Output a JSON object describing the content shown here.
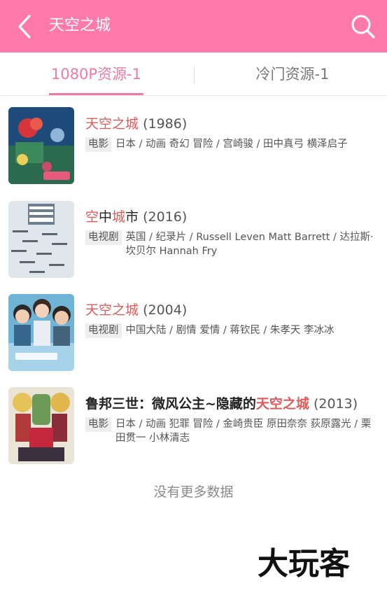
{
  "header": {
    "title": "天空之城",
    "back_icon": "chevron-left-icon",
    "search_icon": "search-icon",
    "bg_color": "#ff7aa8"
  },
  "tabs": [
    {
      "label": "1080P资源-1",
      "active": true
    },
    {
      "label": "冷门资源-1",
      "active": false
    }
  ],
  "results": [
    {
      "title_parts": [
        {
          "text": "天空之城",
          "hl": true
        }
      ],
      "year": "(1986)",
      "tag": "电影",
      "meta": "日本 / 动画 奇幻 冒险 / 宫崎骏 / 田中真弓 横泽启子"
    },
    {
      "title_parts": [
        {
          "text": "空",
          "hl": true
        },
        {
          "text": "中",
          "hl": false
        },
        {
          "text": "城",
          "hl": true
        },
        {
          "text": "市",
          "hl": false
        }
      ],
      "year": "(2016)",
      "tag": "电视剧",
      "meta": "英国 / 纪录片 / Russell Leven Matt Barrett / 达拉斯·坎贝尔 Hannah Fry"
    },
    {
      "title_parts": [
        {
          "text": "天空之城",
          "hl": true
        }
      ],
      "year": "(2004)",
      "tag": "电视剧",
      "meta": "中国大陆 / 剧情 爱情 / 蒋钦民 / 朱孝天 李冰冰"
    },
    {
      "title_parts": [
        {
          "text": "鲁邦三世：微风公主~隐藏的",
          "hl": false
        },
        {
          "text": "天空之城",
          "hl": true
        }
      ],
      "year": "(2013)",
      "tag": "电影",
      "meta": "日本 / 动画 犯罪 冒险 / 金崎贵臣 原田奈奈 荻原露光 / 栗田贯一 小林清志"
    }
  ],
  "footer": {
    "no_more": "没有更多数据"
  },
  "watermark": {
    "text": "大玩客"
  }
}
